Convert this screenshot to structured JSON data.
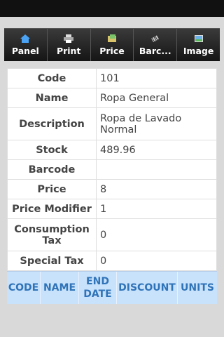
{
  "toolbar": {
    "buttons": [
      {
        "label": "Panel",
        "icon": "home-icon"
      },
      {
        "label": "Print",
        "icon": "printer-icon"
      },
      {
        "label": "Price",
        "icon": "price-tag-icon"
      },
      {
        "label": "Barc...",
        "icon": "barcode-icon"
      },
      {
        "label": "Image",
        "icon": "image-icon"
      }
    ]
  },
  "details": [
    {
      "key": "Code",
      "value": "101"
    },
    {
      "key": "Name",
      "value": "Ropa General"
    },
    {
      "key": "Description",
      "value": "Ropa de Lavado Normal"
    },
    {
      "key": "Stock",
      "value": "489.96"
    },
    {
      "key": "Barcode",
      "value": ""
    },
    {
      "key": "Price",
      "value": "8"
    },
    {
      "key": "Price Modifier",
      "value": "1"
    },
    {
      "key": "Consumption Tax",
      "value": "0"
    },
    {
      "key": "Special Tax",
      "value": "0"
    }
  ],
  "subtable": {
    "headers": [
      "CODE",
      "NAME",
      "END DATE",
      "DISCOUNT",
      "UNITS"
    ]
  },
  "colors": {
    "header_bg": "#c8e2fb",
    "header_text": "#2f73b8",
    "toolbar_bg": "#151515"
  }
}
